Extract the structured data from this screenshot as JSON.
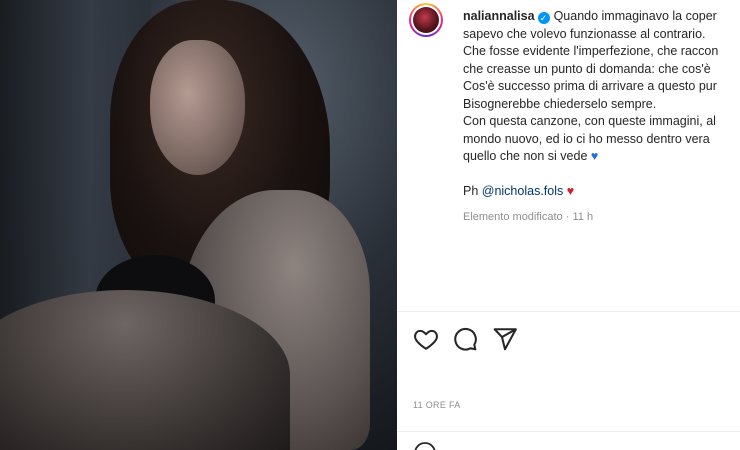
{
  "post": {
    "username": "naliannalisa",
    "caption_lines": [
      "Quando immaginavo la coper",
      "sapevo che volevo funzionasse al contrario.",
      "Che fosse evidente l'imperfezione, che raccon",
      "che creasse un punto di domanda: che cos'è",
      "Cos'è successo prima di arrivare a questo pur",
      "Bisognerebbe chiederselo sempre.",
      "Con questa canzone, con queste immagini, al",
      "mondo nuovo, ed io ci ho messo dentro vera",
      "quello che non si vede"
    ],
    "credit_prefix": "Ph ",
    "credit_mention": "@nicholas.fols",
    "edited_label": "Elemento modificato",
    "edited_time": "11 h",
    "time_ago": "11 ORE FA"
  },
  "icons": {
    "like": "heart-outline-icon",
    "comment": "comment-icon",
    "share": "paper-plane-icon",
    "verified": "verified-badge-icon",
    "blue_heart": "blue-heart-emoji",
    "red_heart": "red-heart-emoji",
    "emoji": "emoji-icon"
  },
  "colors": {
    "text": "#262626",
    "muted": "#8e8e8e",
    "mention": "#00376b",
    "verified": "#0095f6",
    "divider": "#efefef"
  }
}
